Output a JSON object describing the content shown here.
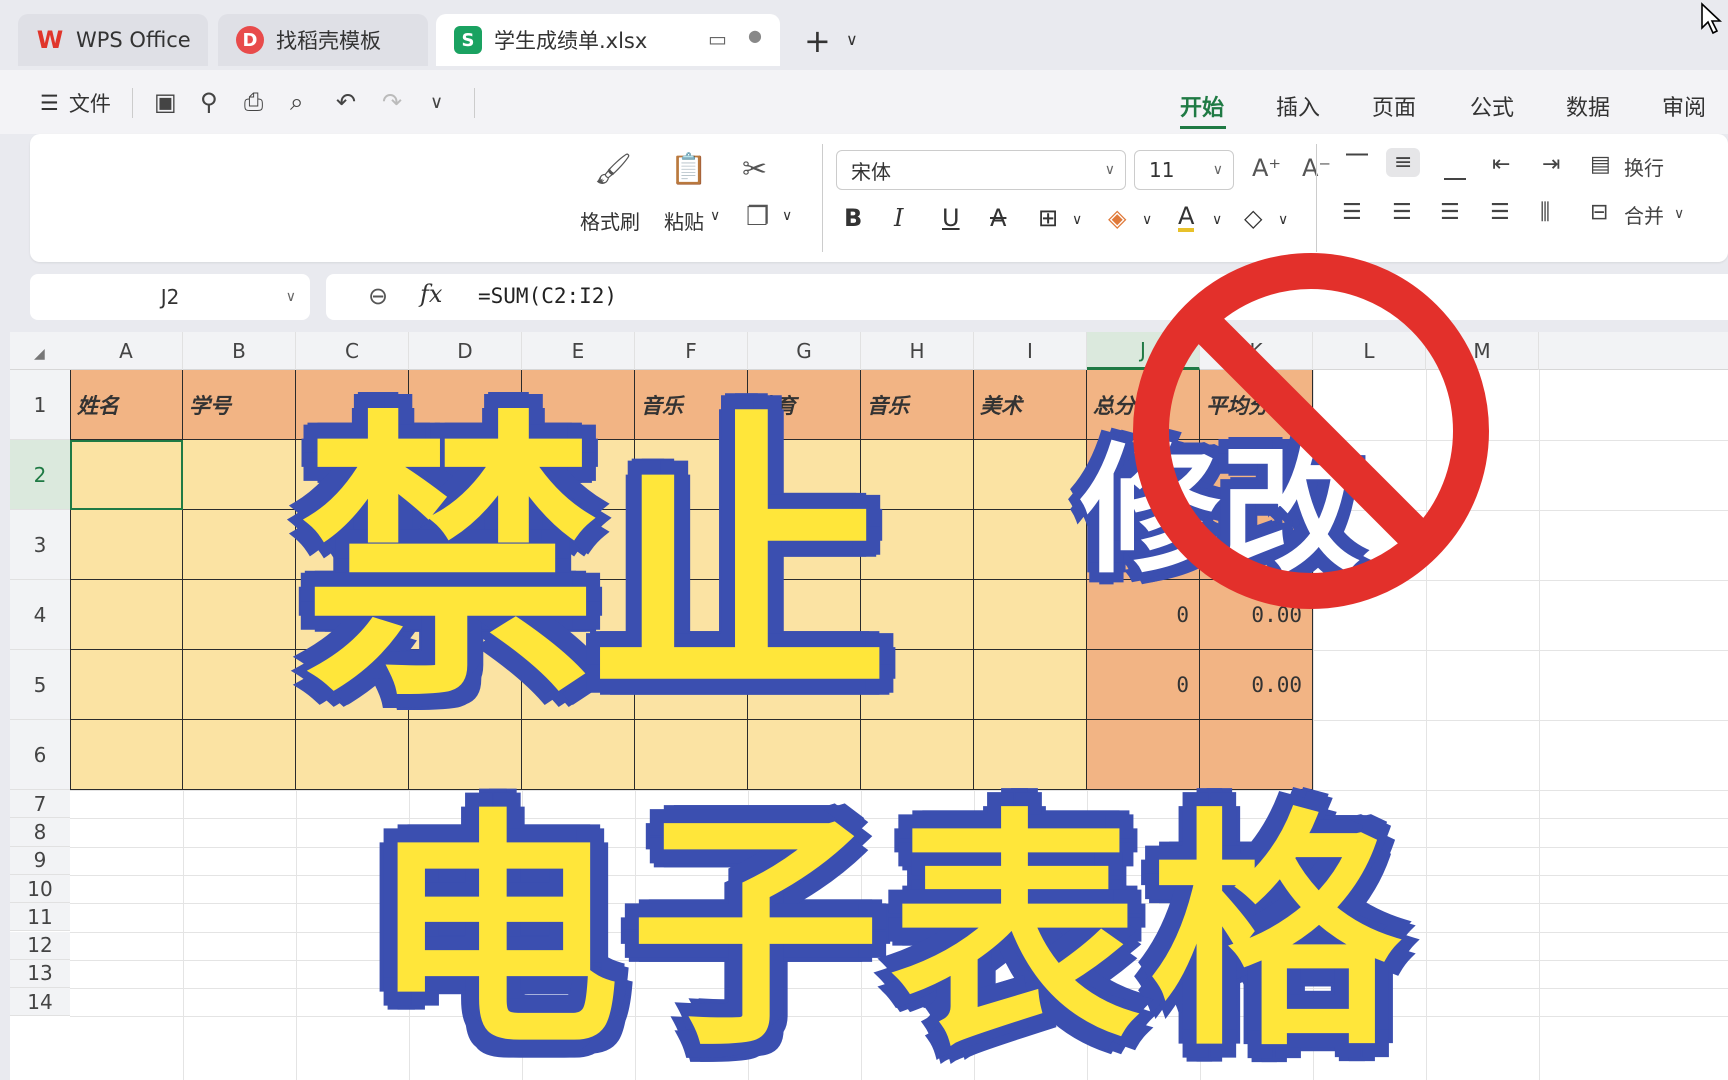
{
  "tabs": [
    {
      "label": "WPS Office",
      "icon": "wps-logo-icon"
    },
    {
      "label": "找稻壳模板",
      "icon": "docer-icon"
    },
    {
      "label": "学生成绩单.xlsx",
      "icon": "spreadsheet-icon",
      "active": true
    }
  ],
  "menu": {
    "file": "文件"
  },
  "ribbon_tabs": [
    "开始",
    "插入",
    "页面",
    "公式",
    "数据",
    "审阅"
  ],
  "ribbon": {
    "format_painter": "格式刷",
    "paste": "粘贴",
    "font_name": "宋体",
    "font_size": "11",
    "wrap": "换行",
    "merge": "合并"
  },
  "formula_bar": {
    "cell_ref": "J2",
    "formula": "=SUM(C2:I2)"
  },
  "columns": [
    "A",
    "B",
    "C",
    "D",
    "E",
    "F",
    "G",
    "H",
    "I",
    "J",
    "K",
    "L",
    "M"
  ],
  "rows": [
    "1",
    "2",
    "3",
    "4",
    "5",
    "6",
    "7",
    "8",
    "9",
    "10",
    "11",
    "12",
    "13",
    "14"
  ],
  "header_row": [
    "姓名",
    "学号",
    "",
    "",
    "",
    "音乐",
    "体育",
    "音乐",
    "美术",
    "总分",
    "平均分"
  ],
  "visible_headers": {
    "A": "姓名",
    "B": "学号",
    "F": "音乐",
    "G": "体育",
    "H": "音乐",
    "I": "美术",
    "J": "总分",
    "K": "平均分"
  },
  "sums": [
    {
      "row": "3",
      "total": "0",
      "avg": "0.00"
    },
    {
      "row": "4",
      "total": "0",
      "avg": "0.00"
    },
    {
      "row": "5",
      "total": "0",
      "avg": "0.00"
    }
  ],
  "overlay": {
    "ban": "禁止",
    "modify": "修改",
    "sheet": "电子表格"
  },
  "colors": {
    "accent": "#1f7a44",
    "header_fill": "#f2b484",
    "body_fill": "#fbe3a3",
    "overlay_yellow": "#ffe63a",
    "overlay_blue": "#3b4fb0",
    "ban_red": "#e3302b"
  }
}
